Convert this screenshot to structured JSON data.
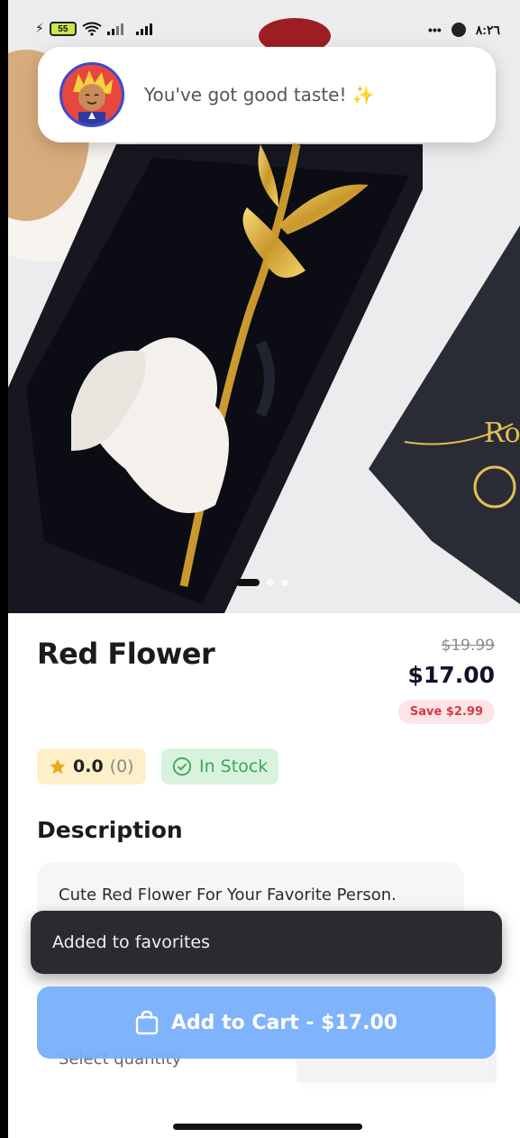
{
  "status_bar": {
    "battery": "55",
    "time": "٨:٢٦",
    "more": "•••"
  },
  "taste_toast": {
    "message": "You've got good taste! ✨"
  },
  "gallery": {
    "total": 3,
    "active_index": 0
  },
  "product": {
    "name": "Red Flower",
    "original_price": "$19.99",
    "price": "$17.00",
    "save_label": "Save $2.99",
    "rating": "0.0",
    "rating_count": "(0)",
    "stock_status": "In Stock",
    "description_heading": "Description",
    "description": "Cute Red Flower For Your Favorite Person."
  },
  "quantity": {
    "label": "Select quantity"
  },
  "snackbar": {
    "message": "Added to favorites"
  },
  "cart_button": {
    "label": "Add to Cart - $17.00"
  },
  "colors": {
    "accent": "#78AFFC",
    "save_badge_bg": "#FDE5E6",
    "save_badge_text": "#D63A48",
    "stock_bg": "#D9F2DE",
    "stock_text": "#3AA656",
    "rating_bg": "#FDF0C8",
    "snackbar_bg": "#2B2B2F"
  }
}
